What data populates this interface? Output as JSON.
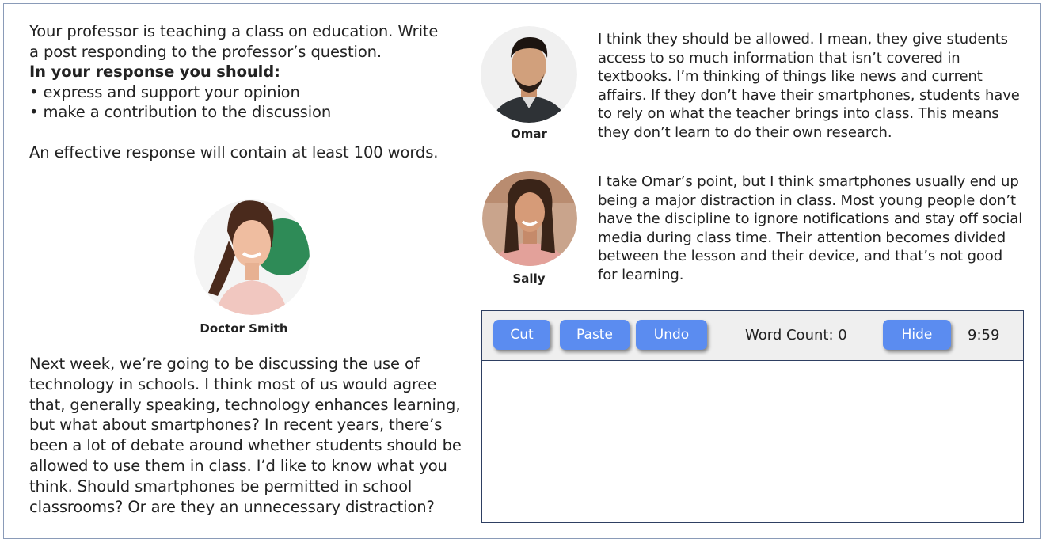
{
  "instructions": {
    "line1": "Your professor is teaching a class on education. Write",
    "line2": "a post responding to the professor’s question.",
    "heading": "In your response you should:",
    "bullet1": "• express and support your opinion",
    "bullet2": "• make a contribution to the discussion",
    "word_requirement": "An effective response will contain at least 100 words."
  },
  "professor": {
    "name": "Doctor Smith",
    "avatar_icon": "person-avatar",
    "question": "Next week, we’re going to be discussing the use of technology in schools. I think most of us would agree that, generally speaking, technology enhances learning, but what about smartphones? In recent years, there’s been a lot of debate around whether students should be allowed to use them in class. I’d like to know what you think. Should smartphones be permitted in school classrooms? Or are they an unnecessary distraction?"
  },
  "students": [
    {
      "name": "Omar",
      "avatar_icon": "person-avatar",
      "post": "I think they should be allowed. I mean, they give students access to so much information that isn’t covered in textbooks. I’m thinking of things like news and current affairs. If they don’t have their smartphones, students have to rely on what the teacher brings into class. This means they don’t learn to do their own research."
    },
    {
      "name": "Sally",
      "avatar_icon": "person-avatar",
      "post": "I take Omar’s point, but I think smartphones usually end up being a major distraction in class. Most young people don’t have the discipline to ignore notifications and stay off social media during class time. Their attention becomes divided between the lesson and their device, and that’s not good for learning."
    }
  ],
  "editor": {
    "cut_label": "Cut",
    "paste_label": "Paste",
    "undo_label": "Undo",
    "word_count_label": "Word Count: 0",
    "hide_label": "Hide",
    "timer": "9:59",
    "response_text": ""
  },
  "colors": {
    "button": "#5b8cf0",
    "frame_border": "#8a9bb8",
    "editor_border": "#2e3f62",
    "toolbar_bg": "#efefef"
  }
}
